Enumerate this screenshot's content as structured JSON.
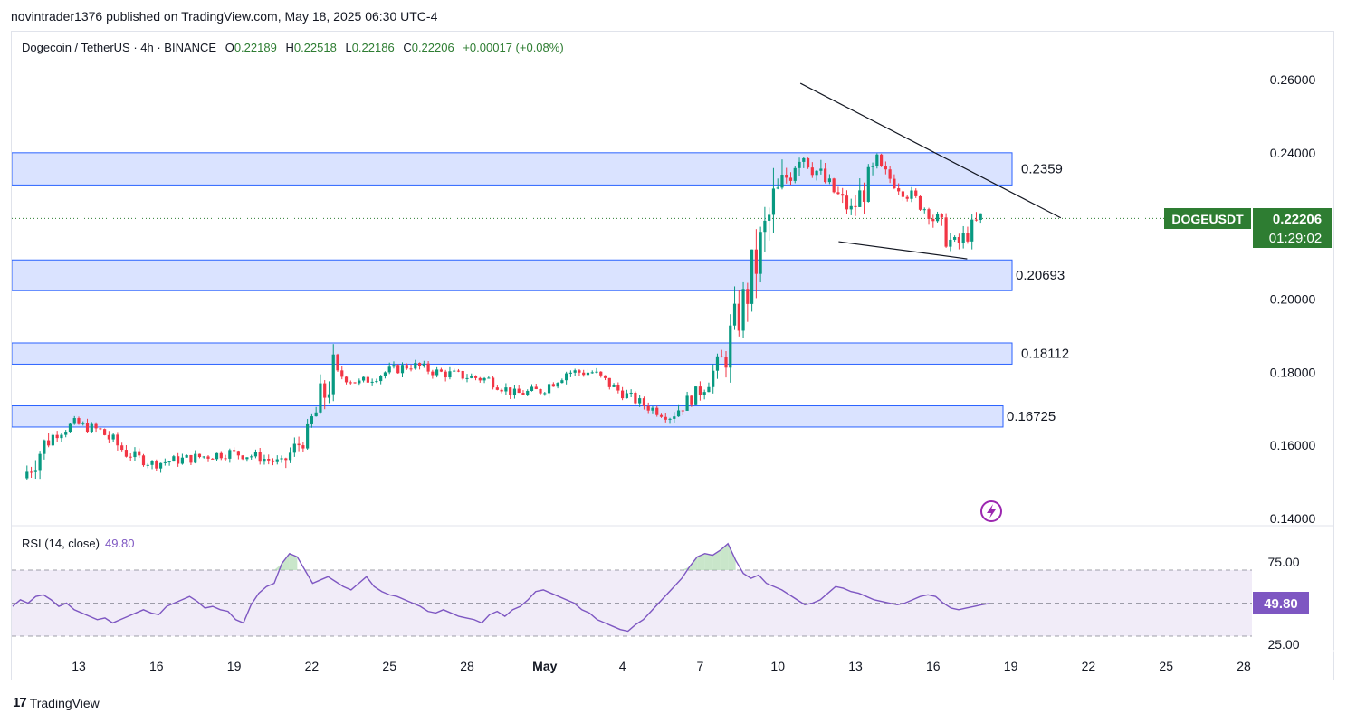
{
  "header": {
    "published_line": "novintrader1376 published on TradingView.com, May 18, 2025 06:30 UTC-4"
  },
  "legend": {
    "symbol": "Dogecoin / TetherUS · 4h · BINANCE",
    "o_label": "O",
    "o_value": "0.22189",
    "h_label": "H",
    "h_value": "0.22518",
    "l_label": "L",
    "l_value": "0.22186",
    "c_label": "C",
    "c_value": "0.22206",
    "change": "+0.00017 (+0.08%)"
  },
  "rsi_legend": {
    "label": "RSI (14, close)",
    "value": "49.80"
  },
  "price_tag": {
    "symbol": "DOGEUSDT",
    "price": "0.22206",
    "countdown": "01:29:02"
  },
  "rsi_tag": {
    "value": "49.80"
  },
  "footer": {
    "brand": "TradingView",
    "logo": "17"
  },
  "icons": {
    "flash": "lightning-icon"
  },
  "colors": {
    "up": "#089981",
    "down": "#f23645",
    "zone": "#d1dcff",
    "zone_border": "#2962ff",
    "rsi": "#7e57c2",
    "tag": "#2e7d32"
  },
  "chart_data": [
    {
      "type": "candlestick",
      "title": "Dogecoin / TetherUS · 4h · BINANCE",
      "y_ticks": [
        "0.26000",
        "0.24000",
        "0.20000",
        "0.18000",
        "0.16000",
        "0.14000"
      ],
      "x_ticks": [
        "13",
        "16",
        "19",
        "22",
        "25",
        "28",
        "May",
        "4",
        "7",
        "10",
        "13",
        "16",
        "19",
        "22",
        "25",
        "28"
      ],
      "ylim": [
        0.14,
        0.26
      ],
      "last_price": 0.22206,
      "approx_close_path": [
        [
          "Apr 11",
          0.151
        ],
        [
          "Apr 12",
          0.162
        ],
        [
          "Apr 13",
          0.166
        ],
        [
          "Apr 14",
          0.164
        ],
        [
          "Apr 15",
          0.158
        ],
        [
          "Apr 16",
          0.155
        ],
        [
          "Apr 17",
          0.156
        ],
        [
          "Apr 18",
          0.157
        ],
        [
          "Apr 19",
          0.158
        ],
        [
          "Apr 20",
          0.157
        ],
        [
          "Apr 21",
          0.155
        ],
        [
          "Apr 22",
          0.163
        ],
        [
          "Apr 23",
          0.18
        ],
        [
          "Apr 24",
          0.177
        ],
        [
          "Apr 25",
          0.18
        ],
        [
          "Apr 26",
          0.182
        ],
        [
          "Apr 27",
          0.18
        ],
        [
          "Apr 28",
          0.179
        ],
        [
          "Apr 29",
          0.178
        ],
        [
          "Apr 30",
          0.174
        ],
        [
          "May 1",
          0.175
        ],
        [
          "May 2",
          0.18
        ],
        [
          "May 3",
          0.18
        ],
        [
          "May 4",
          0.175
        ],
        [
          "May 5",
          0.171
        ],
        [
          "May 6",
          0.168
        ],
        [
          "May 7",
          0.174
        ],
        [
          "May 8",
          0.183
        ],
        [
          "May 9",
          0.202
        ],
        [
          "May 10",
          0.226
        ],
        [
          "May 11",
          0.241
        ],
        [
          "May 12",
          0.232
        ],
        [
          "May 13",
          0.224
        ],
        [
          "May 14",
          0.236
        ],
        [
          "May 15",
          0.23
        ],
        [
          "May 16",
          0.224
        ],
        [
          "May 17",
          0.214
        ],
        [
          "May 18",
          0.222
        ]
      ],
      "zones": [
        {
          "label": "0.2359",
          "low": 0.2312,
          "high": 0.24
        },
        {
          "label": "0.20693",
          "low": 0.2023,
          "high": 0.2107
        },
        {
          "label": "0.18112",
          "low": 0.1822,
          "high": 0.188
        },
        {
          "label": "0.16725",
          "low": 0.165,
          "high": 0.1708
        }
      ],
      "trendlines": [
        {
          "name": "upper",
          "from": [
            "May 10",
            0.259
          ],
          "to": [
            "May 21",
            0.2222
          ]
        },
        {
          "name": "lower",
          "from": [
            "May 12",
            0.2157
          ],
          "to": [
            "May 17",
            0.211
          ]
        }
      ]
    },
    {
      "type": "line",
      "title": "RSI (14, close)",
      "y_ticks": [
        "75.00",
        "25.00"
      ],
      "ylim": [
        25,
        75
      ],
      "band": [
        30,
        70
      ],
      "midline": 50,
      "last_value": 49.8,
      "values": [
        48,
        52,
        50,
        54,
        55,
        52,
        48,
        50,
        46,
        44,
        42,
        40,
        41,
        38,
        40,
        42,
        44,
        46,
        44,
        43,
        48,
        50,
        52,
        54,
        51,
        47,
        48,
        46,
        45,
        40,
        38,
        49,
        56,
        60,
        62,
        74,
        80,
        78,
        70,
        62,
        64,
        66,
        63,
        60,
        58,
        62,
        66,
        60,
        57,
        55,
        54,
        52,
        50,
        48,
        45,
        44,
        46,
        44,
        42,
        41,
        40,
        38,
        43,
        45,
        42,
        46,
        48,
        52,
        57,
        58,
        56,
        54,
        52,
        50,
        46,
        44,
        40,
        38,
        36,
        34,
        33,
        37,
        40,
        45,
        50,
        55,
        60,
        65,
        72,
        78,
        80,
        79,
        82,
        86,
        76,
        68,
        65,
        67,
        62,
        60,
        58,
        55,
        52,
        49,
        50,
        52,
        56,
        60,
        59,
        57,
        56,
        54,
        52,
        51,
        50,
        49,
        50,
        52,
        54,
        55,
        54,
        50,
        47,
        46,
        47,
        48,
        49,
        49.8
      ]
    }
  ]
}
